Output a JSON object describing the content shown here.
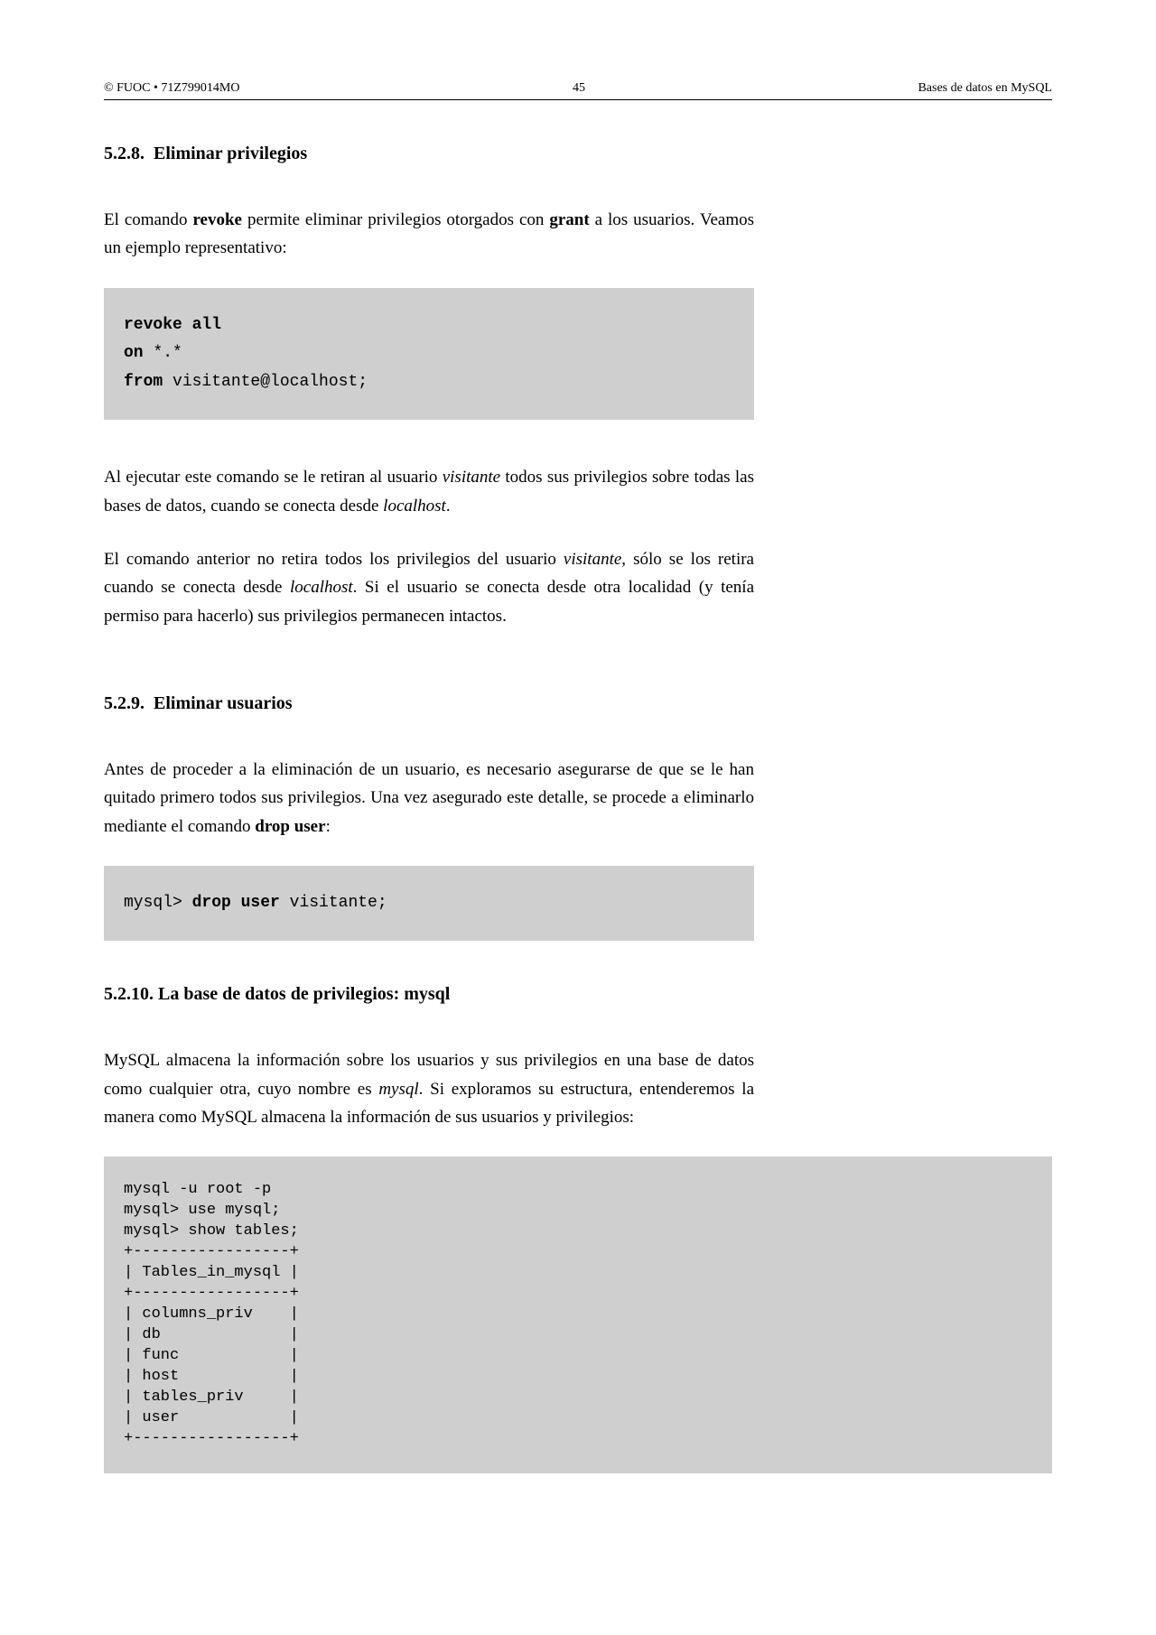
{
  "header": {
    "left": "© FUOC • 71Z799014MO",
    "center": "45",
    "right": "Bases de datos en MySQL"
  },
  "section1": {
    "number": "5.2.8.",
    "title": "Eliminar privilegios",
    "p1_a": "El comando ",
    "p1_b": "revoke",
    "p1_c": " permite eliminar privilegios otorgados con ",
    "p1_d": "grant",
    "p1_e": " a los usuarios. Veamos un ejemplo representativo:",
    "code_l1a": "revoke all",
    "code_l2a": "on",
    "code_l2b": " *.*",
    "code_l3a": "from",
    "code_l3b": " visitante@localhost;",
    "p2_a": "Al ejecutar este comando se le retiran al usuario ",
    "p2_b": "visitante",
    "p2_c": " todos sus privilegios sobre todas las bases de datos, cuando se conecta desde ",
    "p2_d": "localhost",
    "p2_e": ".",
    "p3_a": "El comando anterior no retira todos los privilegios del usuario ",
    "p3_b": "visitante",
    "p3_c": ", sólo se los retira cuando se conecta desde ",
    "p3_d": "localhost",
    "p3_e": ". Si el usuario se conecta desde otra localidad (y tenía permiso para hacerlo) sus privilegios permanecen intactos."
  },
  "section2": {
    "number": "5.2.9.",
    "title": "Eliminar usuarios",
    "p1_a": "Antes de proceder a la eliminación de un usuario, es necesario asegurarse de que se le han quitado primero todos sus privilegios. Una vez asegurado este detalle, se procede a eliminarlo mediante el comando ",
    "p1_b": "drop user",
    "p1_c": ":",
    "code_pre": "mysql> ",
    "code_cmd": "drop user",
    "code_post": " visitante;"
  },
  "section3": {
    "number": "5.2.10.",
    "title": "La base de datos de privilegios: mysql",
    "p1_a": "MySQL almacena la información sobre los usuarios y sus privilegios en una base de datos como cualquier otra, cuyo nombre es ",
    "p1_b": "mysql",
    "p1_c": ". Si exploramos su estructura, entenderemos la manera como MySQL almacena la información de sus usuarios y privilegios:",
    "code": "mysql -u root -p\nmysql> use mysql;\nmysql> show tables;\n+-----------------+\n| Tables_in_mysql |\n+-----------------+\n| columns_priv    |\n| db              |\n| func            |\n| host            |\n| tables_priv     |\n| user            |\n+-----------------+"
  }
}
